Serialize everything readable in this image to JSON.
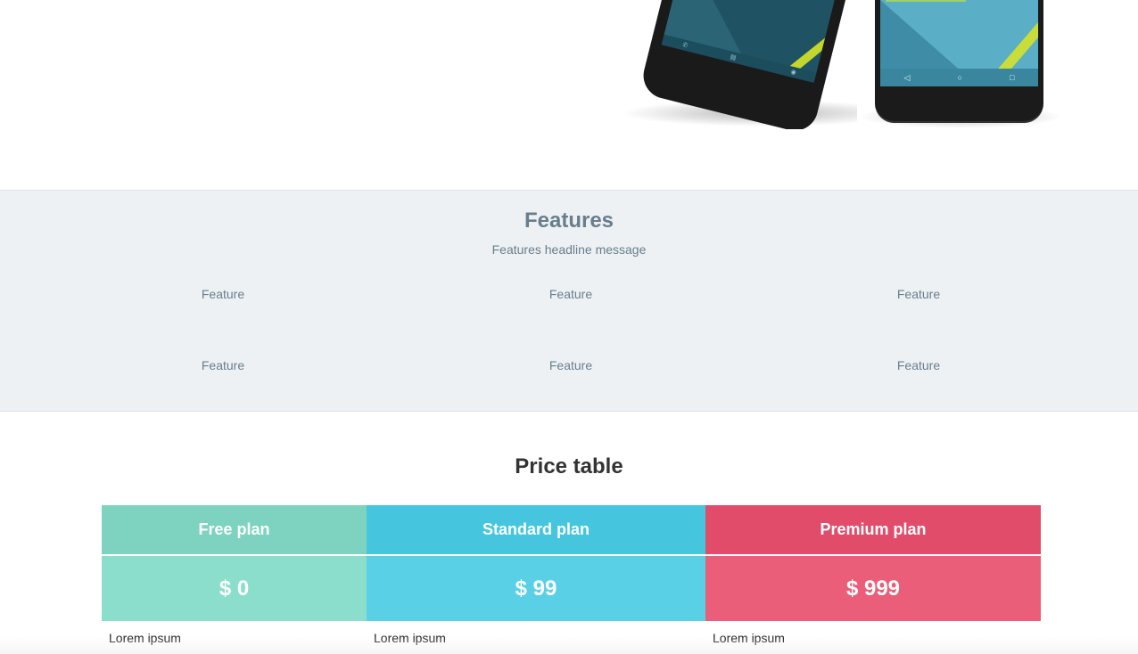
{
  "features": {
    "title": "Features",
    "headline": "Features headline message",
    "items": [
      "Feature",
      "Feature",
      "Feature",
      "Feature",
      "Feature",
      "Feature"
    ]
  },
  "price_table": {
    "title": "Price table",
    "plans": [
      {
        "name": "Free plan",
        "price": "$ 0",
        "rows": [
          "Lorem ipsum"
        ],
        "header_color": "#7dd3c0",
        "price_color": "#8bdecb"
      },
      {
        "name": "Standard plan",
        "price": "$ 99",
        "rows": [
          "Lorem ipsum"
        ],
        "header_color": "#45c6de",
        "price_color": "#59d0e6"
      },
      {
        "name": "Premium plan",
        "price": "$ 999",
        "rows": [
          "Lorem ipsum"
        ],
        "header_color": "#e14c6b",
        "price_color": "#ea5e7a"
      }
    ]
  },
  "hero": {
    "images": [
      "phone-angled-image",
      "phone-front-image"
    ]
  }
}
